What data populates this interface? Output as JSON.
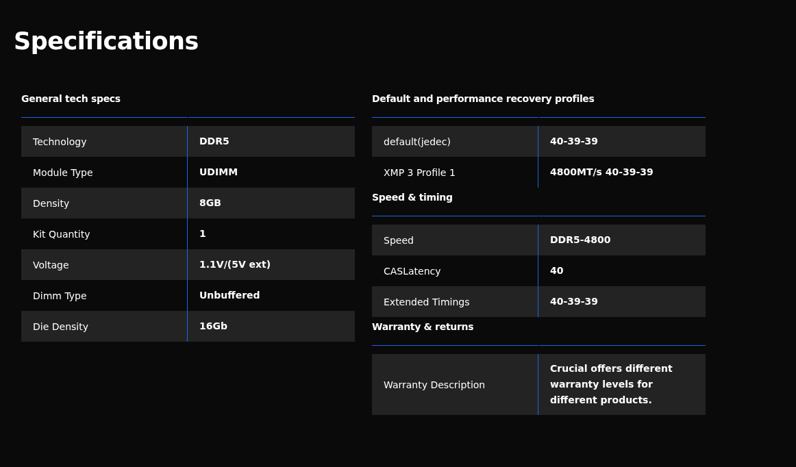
{
  "title": "Specifications",
  "columns": [
    {
      "sections": [
        {
          "heading": "General tech specs",
          "rows": [
            {
              "label": "Technology",
              "value": "DDR5"
            },
            {
              "label": "Module Type",
              "value": "UDIMM"
            },
            {
              "label": "Density",
              "value": "8GB"
            },
            {
              "label": "Kit Quantity",
              "value": "1"
            },
            {
              "label": "Voltage",
              "value": "1.1V/(5V ext)"
            },
            {
              "label": "Dimm Type",
              "value": "Unbuffered"
            },
            {
              "label": "Die Density",
              "value": "16Gb"
            }
          ]
        }
      ]
    },
    {
      "sections": [
        {
          "heading": "Default and performance recovery profiles",
          "rows": [
            {
              "label": "default(jedec)",
              "value": "40-39-39"
            },
            {
              "label": "XMP 3 Profile 1",
              "value": "4800MT/s 40-39-39"
            }
          ]
        },
        {
          "heading": "Speed & timing",
          "rows": [
            {
              "label": "Speed",
              "value": "DDR5-4800"
            },
            {
              "label": "CASLatency",
              "value": "40"
            },
            {
              "label": "Extended Timings",
              "value": "40-39-39"
            }
          ]
        },
        {
          "heading": "Warranty & returns",
          "rows": [
            {
              "label": "Warranty Description",
              "value": "Crucial offers different warranty levels for different products."
            }
          ]
        }
      ]
    }
  ]
}
